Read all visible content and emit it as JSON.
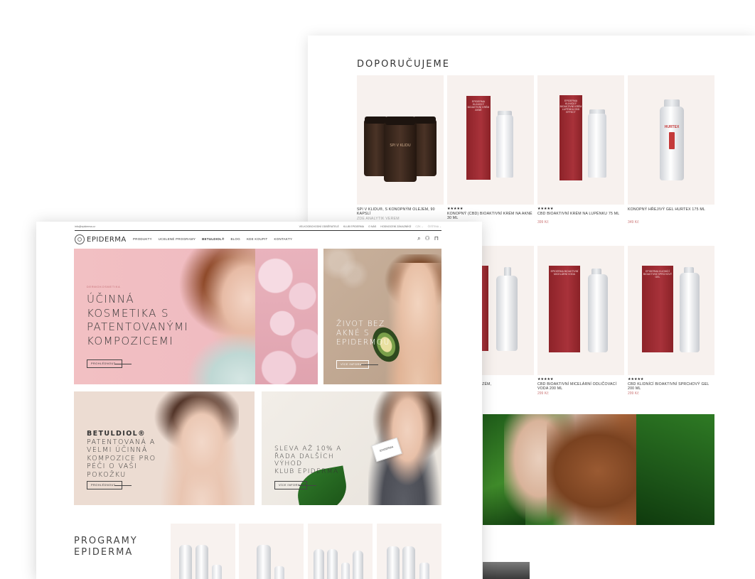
{
  "back": {
    "heading": "DOPORUČUJEME",
    "row1": [
      {
        "name": "SPI V KLIDU®, S KONOPNÝM OLEJEM, 90 KAPSLÍ",
        "extra": "ZDE ANALYTIK VEREM",
        "stars": "",
        "price": "",
        "kind": "jars",
        "jar_label": "SPI V KLIDU"
      },
      {
        "name": "KONOPNÝ (CBD) BIOAKTIVNÍ KRÉM NA AKNÉ 30 ML",
        "extra": "",
        "stars": "★★★★★",
        "price": "",
        "kind": "box-tube",
        "box_label": "EPIDERMA KLINICKÝ BIOAKTIVNÍ KRÉM AKNÉ"
      },
      {
        "name": "CBD BIOAKTIVNÍ KRÉM NA LUPÉNKU 75 ML",
        "extra": "",
        "stars": "★★★★★",
        "price": "399 Kč",
        "kind": "box-tube",
        "box_label": "EPIDERMA KLINICKÝ BIOAKTIVNÍ KRÉM LUPÉNKA CBD EFFECT"
      },
      {
        "name": "KONOPNÝ HŘEJIVÝ GEL HURTEX 175 ML",
        "extra": "",
        "stars": "",
        "price": "349 Kč",
        "kind": "bottle",
        "bottle_label": "HURTEX"
      }
    ],
    "row2": [
      {
        "name": "NÝ BALZÁM NA EXZÉM,",
        "stars": "",
        "price": ""
      },
      {
        "name": "CBD BIOAKTIVNÍ MICELÁRNÍ ODLIČOVACÍ VODA 200 ML",
        "stars": "★★★★★",
        "price": "299 Kč",
        "box_label": "EPIDERMA BIOAKTIVNÍ MICELÁRNÍ VODA"
      },
      {
        "name": "CBD KLIDNÍCÍ BIOAKTIVNÍ SPRCHOVÝ GEL 200 ML",
        "stars": "★★★★★",
        "price": "299 Kč",
        "box_label": "EPIDERMA KLIDNÍCÍ BIOAKTIVNÍ SPRCHOVÝ GEL"
      }
    ]
  },
  "front": {
    "topbar": {
      "email": "info@epiderma.cz",
      "links": [
        "VELKOOBCHODNÍ ODBĚRATELÉ",
        "KLUB EPIDERMA",
        "O NÁS",
        "HODNOCENÍ ZÁKAZNÍKŮ",
        "CZK ⌄",
        "ČEŠTINA ⌄"
      ]
    },
    "logo": "EPIDERMA",
    "menu": [
      "PRODUKTY",
      "UCELENÉ PROGRAMY",
      "BETULDIOL®",
      "BLOG",
      "KDE KOUPIT",
      "KONTAKTY"
    ],
    "icons": [
      "search-icon",
      "user-icon",
      "bag-icon"
    ],
    "hero": {
      "eyebrow": "DERMOKOSMETIKA",
      "title_lines": [
        "ÚČINNÁ",
        "KOSMETIKA S",
        "PATENTOVANÝMI",
        "KOMPOZICEMI"
      ],
      "button": "PROHLÉDNOUT"
    },
    "tile2": {
      "title_lines": [
        "ŽIVOT BEZ",
        "AKNÉ S",
        "EPIDERMOU"
      ],
      "button": "VÍCE INFORMACÍ"
    },
    "tile3": {
      "title_bold": "BETULDIOL®",
      "title_lines": [
        "PATENTOVANÁ A",
        "VELMI ÚČINNÁ",
        "KOMPOZICE PRO",
        "PÉČI O VAŠI",
        "POKOŽKU"
      ],
      "button": "PROHLÉDNOUT"
    },
    "tile4": {
      "title_lines": [
        "SLEVA AŽ 10% A",
        "ŘADA DALŠÍCH",
        "VÝHOD",
        "KLUB EPIDERMA"
      ],
      "card_label": "EPIDERMA",
      "button": "VÍCE INFORMACÍ"
    },
    "programs_title_lines": [
      "PROGRAMY",
      "EPIDERMA"
    ]
  },
  "colors": {
    "brand_red": "#a8323a",
    "hero_pink": "#f2c0c3",
    "accent": "#c46e74"
  }
}
